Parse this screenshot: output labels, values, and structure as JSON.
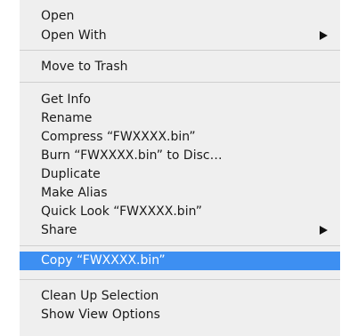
{
  "context_menu": {
    "group1": {
      "open": "Open",
      "open_with": "Open With"
    },
    "group2": {
      "move_to_trash": "Move to Trash"
    },
    "group3": {
      "get_info": "Get Info",
      "rename": "Rename",
      "compress": "Compress “FWXXXX.bin”",
      "burn": "Burn “FWXXXX.bin” to Disc…",
      "duplicate": "Duplicate",
      "make_alias": "Make Alias",
      "quick_look": "Quick Look “FWXXXX.bin”",
      "share": "Share"
    },
    "group4": {
      "copy": "Copy “FWXXXX.bin”"
    },
    "group5": {
      "clean_up_selection": "Clean Up Selection",
      "show_view_options": "Show View Options"
    },
    "highlighted_item": "Copy “FWXXXX.bin”",
    "highlight_color": "#3d8ff2",
    "menu_background": "#efefef",
    "submenu_icon": "triangle-right-icon"
  }
}
